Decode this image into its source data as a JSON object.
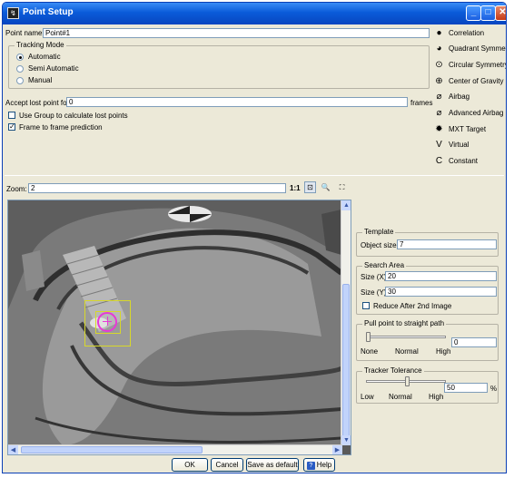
{
  "window": {
    "title": "Point Setup",
    "icon": "point-setup-icon"
  },
  "point_name": {
    "label": "Point name:",
    "value": "Point#1"
  },
  "tracking_mode": {
    "legend": "Tracking Mode",
    "options": [
      "Automatic",
      "Semi Automatic",
      "Manual"
    ],
    "selected": "Automatic"
  },
  "accept_lost": {
    "label": "Accept lost point for",
    "value": "0",
    "unit": "frames"
  },
  "checks": {
    "use_group": {
      "label": "Use Group to calculate lost points",
      "checked": false
    },
    "frame_prediction": {
      "label": "Frame to frame prediction",
      "checked": true
    }
  },
  "methods": [
    {
      "label": "Correlation",
      "icon": "correlation-icon",
      "glyph": "●"
    },
    {
      "label": "Quadrant Symmetry",
      "icon": "quadrant-symmetry-icon",
      "glyph": "◕"
    },
    {
      "label": "Circular Symmetry",
      "icon": "circular-symmetry-icon",
      "glyph": "⊙"
    },
    {
      "label": "Center of Gravity",
      "icon": "center-of-gravity-icon",
      "glyph": "⊕"
    },
    {
      "label": "Airbag",
      "icon": "airbag-icon",
      "glyph": "⌀"
    },
    {
      "label": "Advanced Airbag",
      "icon": "advanced-airbag-icon",
      "glyph": "⌀"
    },
    {
      "label": "MXT Target",
      "icon": "mxt-target-icon",
      "glyph": "✹"
    },
    {
      "label": "Virtual",
      "icon": "virtual-icon",
      "glyph": "V"
    },
    {
      "label": "Constant",
      "icon": "constant-icon",
      "glyph": "C"
    }
  ],
  "zoom": {
    "label": "Zoom:",
    "value": "2",
    "one_to_one": "1:1"
  },
  "template": {
    "legend": "Template",
    "object_size_label": "Object size",
    "object_size": "7"
  },
  "search_area": {
    "legend": "Search Area",
    "size_x_label": "Size (X)",
    "size_x": "20",
    "size_y_label": "Size (Y)",
    "size_y": "30",
    "reduce_label": "Reduce After 2nd Image",
    "reduce_checked": false
  },
  "pull_point": {
    "legend": "Pull point to straight path",
    "value": "0",
    "level": 0.0,
    "ticks": [
      "None",
      "Normal",
      "High"
    ]
  },
  "tracker_tolerance": {
    "legend": "Tracker Tolerance",
    "value": "50",
    "unit": "%",
    "level": 0.5,
    "ticks": [
      "Low",
      "Normal",
      "High"
    ]
  },
  "buttons": {
    "ok": "OK",
    "cancel": "Cancel",
    "save_default": "Save as default",
    "help": "Help"
  },
  "colors": {
    "title_bar": "#0a5bd9",
    "marker": "#e63ad6",
    "search_box": "#d8d82a"
  }
}
